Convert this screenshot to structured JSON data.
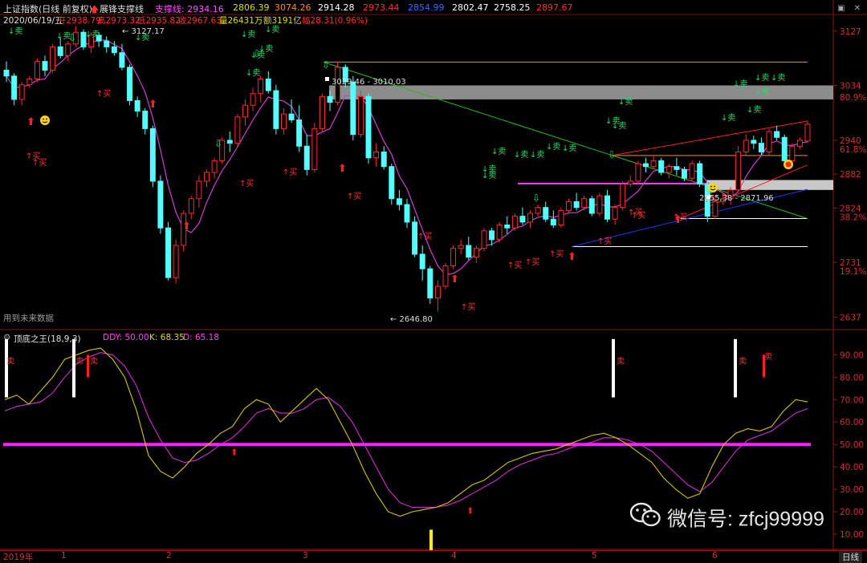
{
  "header": {
    "title": "上证指数(日线 前复权)",
    "indicator_name": "展锋支撑线",
    "support_label": "支撑线: 2934.16",
    "values": [
      "2806.39",
      "3074.26",
      "2914.28",
      "2973.44",
      "2854.99",
      "2802.47",
      "2758.25",
      "2897.67"
    ],
    "value_colors": [
      "#dddd00",
      "#ff8c1a",
      "#ffffff",
      "#ff3030",
      "#3a6bff",
      "#ffffff",
      "#ffffff",
      "#ff3030"
    ]
  },
  "info": {
    "date": "2020/06/19/五",
    "open": "开2938.79",
    "high": "高2973.32",
    "low": "低2935.82",
    "close": "收2967.63",
    "volume": "量26431万",
    "amount": "额3191亿",
    "change": "幅28.31(0.96%)"
  },
  "main_chart": {
    "y_ticks": [
      "3127",
      "3034",
      "2940",
      "2882",
      "2824",
      "2731",
      "2637"
    ],
    "pct_ticks": [
      "80.9%",
      "61.8%",
      "38.2%",
      "19.1%"
    ],
    "annotations": [
      "3127.17",
      "3029.46 - 3010.03",
      "2855.38 - 2871.96",
      "2646.80"
    ],
    "note": "用到未来数据"
  },
  "chart_data": {
    "type": "candlestick",
    "y_range": [
      2620,
      3150
    ],
    "candles": [
      [
        3060,
        3075,
        3040,
        3050
      ],
      [
        3050,
        3055,
        3000,
        3010
      ],
      [
        3010,
        3040,
        3000,
        3035
      ],
      [
        3035,
        3050,
        3030,
        3045
      ],
      [
        3045,
        3080,
        3040,
        3075
      ],
      [
        3075,
        3085,
        3050,
        3060
      ],
      [
        3060,
        3105,
        3055,
        3100
      ],
      [
        3100,
        3115,
        3080,
        3085
      ],
      [
        3085,
        3110,
        3075,
        3105
      ],
      [
        3105,
        3135,
        3100,
        3125
      ],
      [
        3125,
        3130,
        3095,
        3100
      ],
      [
        3100,
        3125,
        3090,
        3120
      ],
      [
        3120,
        3125,
        3100,
        3110
      ],
      [
        3110,
        3118,
        3090,
        3100
      ],
      [
        3100,
        3110,
        3085,
        3090
      ],
      [
        3090,
        3105,
        3060,
        3065
      ],
      [
        3065,
        3070,
        3000,
        3008
      ],
      [
        3008,
        3015,
        2980,
        2990
      ],
      [
        2990,
        2995,
        2950,
        2960
      ],
      [
        2960,
        2965,
        2860,
        2870
      ],
      [
        2870,
        2880,
        2780,
        2790
      ],
      [
        2790,
        2800,
        2700,
        2705
      ],
      [
        2705,
        2770,
        2695,
        2760
      ],
      [
        2760,
        2820,
        2750,
        2815
      ],
      [
        2815,
        2845,
        2805,
        2840
      ],
      [
        2840,
        2880,
        2825,
        2870
      ],
      [
        2870,
        2890,
        2860,
        2885
      ],
      [
        2885,
        2910,
        2875,
        2905
      ],
      [
        2905,
        2945,
        2900,
        2940
      ],
      [
        2940,
        2955,
        2920,
        2935
      ],
      [
        2935,
        2985,
        2930,
        2980
      ],
      [
        2980,
        3010,
        2965,
        3000
      ],
      [
        3000,
        3030,
        2990,
        3020
      ],
      [
        3020,
        3050,
        3005,
        3045
      ],
      [
        3045,
        3058,
        3020,
        3025
      ],
      [
        3025,
        3035,
        2950,
        2960
      ],
      [
        2960,
        2995,
        2950,
        2985
      ],
      [
        2985,
        3010,
        2970,
        2975
      ],
      [
        2975,
        3000,
        2920,
        2930
      ],
      [
        2930,
        2950,
        2880,
        2890
      ],
      [
        2890,
        2970,
        2885,
        2960
      ],
      [
        2960,
        3020,
        2955,
        3015
      ],
      [
        3015,
        3025,
        2990,
        3005
      ],
      [
        3005,
        3075,
        3000,
        3065
      ],
      [
        3065,
        3070,
        3030,
        3040
      ],
      [
        3040,
        3050,
        2940,
        2950
      ],
      [
        2950,
        3025,
        2945,
        3015
      ],
      [
        3015,
        3020,
        2900,
        2910
      ],
      [
        2910,
        2935,
        2895,
        2920
      ],
      [
        2920,
        2930,
        2890,
        2895
      ],
      [
        2895,
        2900,
        2830,
        2840
      ],
      [
        2840,
        2855,
        2820,
        2830
      ],
      [
        2830,
        2840,
        2790,
        2800
      ],
      [
        2800,
        2810,
        2740,
        2745
      ],
      [
        2745,
        2760,
        2700,
        2720
      ],
      [
        2720,
        2725,
        2660,
        2670
      ],
      [
        2670,
        2700,
        2646.8,
        2690
      ],
      [
        2690,
        2730,
        2685,
        2725
      ],
      [
        2725,
        2760,
        2720,
        2755
      ],
      [
        2755,
        2770,
        2745,
        2760
      ],
      [
        2760,
        2775,
        2735,
        2740
      ],
      [
        2740,
        2760,
        2730,
        2755
      ],
      [
        2755,
        2790,
        2750,
        2785
      ],
      [
        2785,
        2790,
        2760,
        2770
      ],
      [
        2770,
        2800,
        2765,
        2795
      ],
      [
        2795,
        2810,
        2780,
        2790
      ],
      [
        2790,
        2815,
        2785,
        2810
      ],
      [
        2810,
        2825,
        2795,
        2800
      ],
      [
        2800,
        2820,
        2790,
        2815
      ],
      [
        2815,
        2830,
        2810,
        2825
      ],
      [
        2825,
        2835,
        2800,
        2805
      ],
      [
        2805,
        2820,
        2790,
        2795
      ],
      [
        2795,
        2825,
        2790,
        2820
      ],
      [
        2820,
        2840,
        2815,
        2835
      ],
      [
        2835,
        2850,
        2820,
        2825
      ],
      [
        2825,
        2845,
        2820,
        2840
      ],
      [
        2840,
        2845,
        2810,
        2815
      ],
      [
        2815,
        2850,
        2810,
        2845
      ],
      [
        2845,
        2855,
        2800,
        2805
      ],
      [
        2805,
        2830,
        2795,
        2825
      ],
      [
        2825,
        2870,
        2820,
        2865
      ],
      [
        2865,
        2880,
        2860,
        2870
      ],
      [
        2870,
        2905,
        2865,
        2900
      ],
      [
        2900,
        2910,
        2885,
        2895
      ],
      [
        2895,
        2915,
        2890,
        2905
      ],
      [
        2905,
        2910,
        2880,
        2885
      ],
      [
        2885,
        2900,
        2875,
        2895
      ],
      [
        2895,
        2910,
        2880,
        2890
      ],
      [
        2890,
        2895,
        2870,
        2875
      ],
      [
        2875,
        2905,
        2870,
        2900
      ],
      [
        2900,
        2905,
        2860,
        2865
      ],
      [
        2865,
        2870,
        2800,
        2810
      ],
      [
        2810,
        2840,
        2805,
        2835
      ],
      [
        2835,
        2850,
        2830,
        2840
      ],
      [
        2840,
        2860,
        2830,
        2855
      ],
      [
        2855,
        2930,
        2850,
        2920
      ],
      [
        2920,
        2950,
        2915,
        2940
      ],
      [
        2940,
        2948,
        2925,
        2935
      ],
      [
        2935,
        2945,
        2915,
        2920
      ],
      [
        2920,
        2960,
        2915,
        2955
      ],
      [
        2955,
        2965,
        2940,
        2945
      ],
      [
        2945,
        2950,
        2900,
        2905
      ],
      [
        2905,
        2935,
        2900,
        2930
      ],
      [
        2930,
        2945,
        2925,
        2940
      ],
      [
        2938.79,
        2973.32,
        2935.82,
        2967.63
      ]
    ],
    "x_labels": [
      "2019年",
      "1",
      "2",
      "3",
      "4",
      "5",
      "6",
      "日线"
    ]
  },
  "indicator": {
    "name": "顶底之王(18,9,3)",
    "ddy": "DDY: 50.00",
    "k": "K: 68.35",
    "d": "D: 65.18",
    "y_ticks": [
      "90.00",
      "80.00",
      "70.00",
      "60.00",
      "50.00",
      "40.00",
      "30.00",
      "20.00",
      "10.00"
    ],
    "y_range": [
      5,
      98
    ],
    "k_values": [
      70,
      72,
      68,
      74,
      80,
      88,
      90,
      92,
      93,
      88,
      80,
      65,
      45,
      38,
      35,
      40,
      46,
      50,
      55,
      58,
      66,
      70,
      68,
      60,
      65,
      70,
      75,
      70,
      60,
      50,
      38,
      28,
      20,
      18,
      20,
      21,
      22,
      24,
      28,
      32,
      34,
      38,
      42,
      44,
      46,
      47,
      48,
      50,
      52,
      54,
      55,
      53,
      50,
      46,
      42,
      35,
      30,
      26,
      28,
      40,
      50,
      55,
      57,
      56,
      58,
      65,
      70,
      69
    ],
    "d_values": [
      65,
      67,
      68,
      69,
      73,
      80,
      86,
      89,
      91,
      90,
      85,
      76,
      62,
      52,
      44,
      42,
      43,
      46,
      50,
      53,
      58,
      64,
      66,
      64,
      64,
      66,
      70,
      71,
      67,
      60,
      50,
      40,
      30,
      24,
      22,
      22,
      22,
      23,
      25,
      28,
      31,
      34,
      38,
      41,
      43,
      45,
      46,
      48,
      50,
      51,
      53,
      53,
      52,
      50,
      47,
      42,
      37,
      32,
      29,
      33,
      40,
      47,
      52,
      54,
      56,
      60,
      64,
      66
    ]
  },
  "watermark": {
    "text": "微信号: zfcj99999"
  }
}
